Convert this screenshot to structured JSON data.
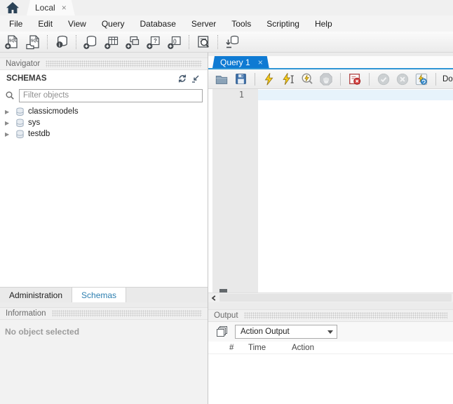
{
  "titlebar": {
    "connection_tab": "Local",
    "close_label": "×"
  },
  "menu": {
    "items": [
      "File",
      "Edit",
      "View",
      "Query",
      "Database",
      "Server",
      "Tools",
      "Scripting",
      "Help"
    ]
  },
  "main_toolbar": {
    "icons": [
      "new-sql-tab",
      "open-sql-file",
      "database-info",
      "new-schema",
      "new-table",
      "new-view",
      "new-procedure",
      "new-function",
      "search-objects",
      "reconnect-dbms"
    ]
  },
  "navigator": {
    "header": "Navigator",
    "section": "SCHEMAS",
    "filter_placeholder": "Filter objects",
    "schemas": [
      {
        "name": "classicmodels"
      },
      {
        "name": "sys"
      },
      {
        "name": "testdb"
      }
    ],
    "tabs": {
      "administration": "Administration",
      "schemas": "Schemas"
    },
    "information_header": "Information",
    "information_text": "No object selected"
  },
  "editor": {
    "tab_label": "Query 1",
    "close_label": "×",
    "line_numbers": [
      "1"
    ],
    "limit_dropdown": "Don't Li"
  },
  "output": {
    "header": "Output",
    "view_selector": "Action Output",
    "columns": [
      "#",
      "Time",
      "Action"
    ]
  },
  "colors": {
    "query_tab_blue": "#0e7ad3",
    "tab_underline_blue": "#2f96d5",
    "schemas_tab_text": "#2d7fb0",
    "current_line_highlight": "#e7f3fb"
  }
}
